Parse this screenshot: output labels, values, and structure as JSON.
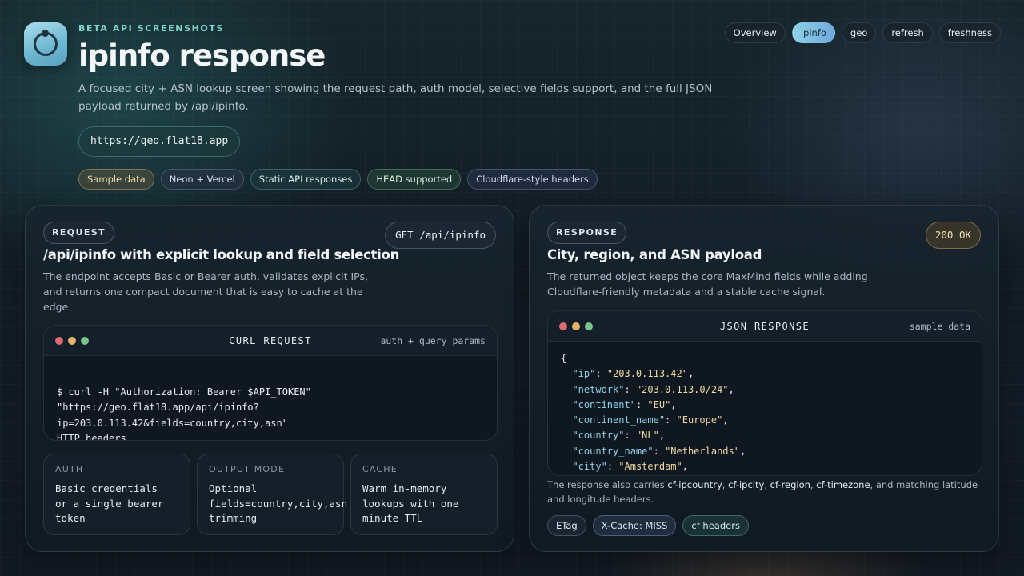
{
  "header": {
    "eyebrow": "BETA API SCREENSHOTS",
    "title": "ipinfo response",
    "subtitle": "A focused city + ASN lookup screen showing the request path, auth model, selective fields support, and the full JSON payload returned by /api/ipinfo.",
    "url": "https://geo.flat18.app",
    "tags": [
      "Sample data",
      "Neon + Vercel",
      "Static API responses",
      "HEAD supported",
      "Cloudflare-style headers"
    ]
  },
  "nav": {
    "tabs": [
      "Overview",
      "ipinfo",
      "geo",
      "refresh",
      "freshness"
    ],
    "active": "ipinfo"
  },
  "request": {
    "label": "REQUEST",
    "method": "GET /api/ipinfo",
    "title": "/api/ipinfo with explicit lookup and field selection",
    "description": "The endpoint accepts Basic or Bearer auth, validates explicit IPs, and returns one compact document that is easy to cache at the edge.",
    "code_title": "CURL REQUEST",
    "code_meta": "auth + query params",
    "code_lines": [
      "$ curl -H \"Authorization: Bearer $API_TOKEN\"",
      "\"https://geo.flat18.app/api/ipinfo?",
      "ip=203.0.113.42&fields=country,city,asn\"",
      "HTTP headers"
    ],
    "cards": [
      {
        "label": "AUTH",
        "value": "Basic credentials\nor a single bearer\ntoken"
      },
      {
        "label": "OUTPUT MODE",
        "value": "Optional\nfields=country,city,asn\ntrimming"
      },
      {
        "label": "CACHE",
        "value": "Warm in-memory\nlookups with one\nminute TTL"
      }
    ]
  },
  "response": {
    "label": "RESPONSE",
    "status": "200 OK",
    "title": "City, region, and ASN payload",
    "description": "The returned object keeps the core MaxMind fields while adding Cloudflare-friendly metadata and a stable cache signal.",
    "code_title": "JSON RESPONSE",
    "code_meta": "sample data",
    "json_fields": [
      {
        "key": "ip",
        "value": "203.0.113.42"
      },
      {
        "key": "network",
        "value": "203.0.113.0/24"
      },
      {
        "key": "continent",
        "value": "EU"
      },
      {
        "key": "continent_name",
        "value": "Europe"
      },
      {
        "key": "country",
        "value": "NL"
      },
      {
        "key": "country_name",
        "value": "Netherlands"
      },
      {
        "key": "city",
        "value": "Amsterdam"
      }
    ],
    "note_prefix": "The response also carries ",
    "note_headers": [
      "cf-ipcountry",
      "cf-ipcity",
      "cf-region",
      "cf-timezone"
    ],
    "note_suffix": ", and matching latitude and longitude headers.",
    "chips": [
      "ETag",
      "X-Cache: MISS",
      "cf headers"
    ]
  }
}
